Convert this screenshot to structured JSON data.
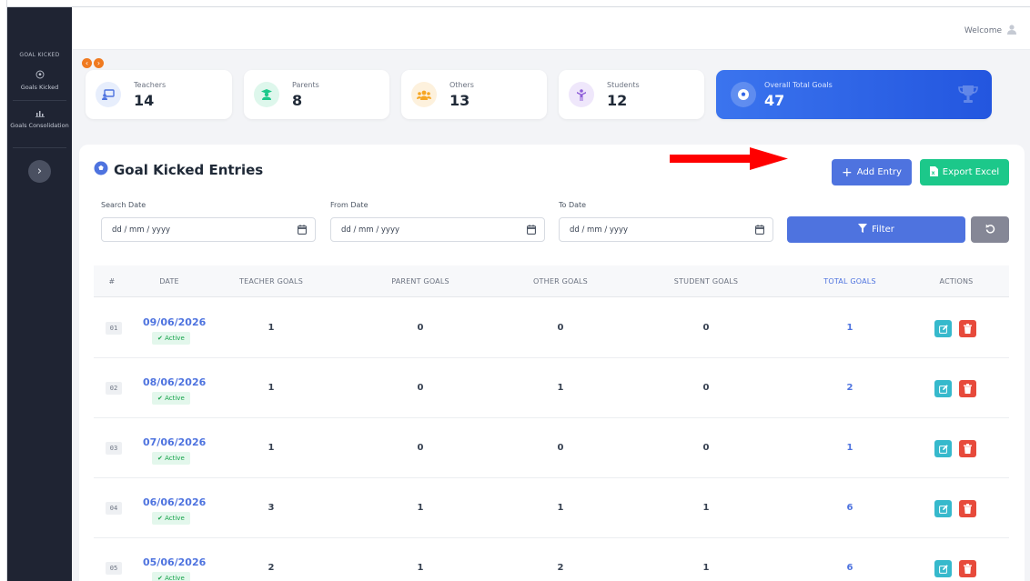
{
  "sidebar": {
    "brand": "GOAL KICKED",
    "items": [
      {
        "label": "Goals Kicked",
        "icon": "soccer-ball-icon"
      },
      {
        "label": "Goals Consolidation",
        "icon": "bar-chart-icon"
      }
    ],
    "toggle_icon": "chevron-right-icon"
  },
  "header": {
    "welcome": "Welcome"
  },
  "stats": [
    {
      "label": "Teachers",
      "value": "14",
      "icon": "chalkboard-teacher-icon",
      "color": "#4e73df",
      "bg": "#e7eefc"
    },
    {
      "label": "Parents",
      "value": "8",
      "icon": "user-graduate-icon",
      "color": "#1cc88a",
      "bg": "#def7ec"
    },
    {
      "label": "Others",
      "value": "13",
      "icon": "users-icon",
      "color": "#f6a623",
      "bg": "#fdf1dd"
    },
    {
      "label": "Students",
      "value": "12",
      "icon": "child-icon",
      "color": "#8e5dd8",
      "bg": "#efe7fb"
    }
  ],
  "total": {
    "label": "Overall Total Goals",
    "value": "47",
    "icon": "soccer-ball-icon"
  },
  "card": {
    "title": "Goal Kicked Entries",
    "add_label": "Add Entry",
    "export_label": "Export Excel",
    "filter_label": "Filter"
  },
  "filters": {
    "search_date": {
      "label": "Search Date",
      "value": "dd / mm / yyyy"
    },
    "from_date": {
      "label": "From Date",
      "value": "dd / mm / yyyy"
    },
    "to_date": {
      "label": "To Date",
      "value": "dd / mm / yyyy"
    }
  },
  "table": {
    "columns": [
      "#",
      "DATE",
      "TEACHER GOALS",
      "PARENT GOALS",
      "OTHER GOALS",
      "STUDENT GOALS",
      "TOTAL GOALS",
      "ACTIONS"
    ],
    "rows": [
      {
        "num": "01",
        "date": "09/06/2026",
        "status": "Active",
        "teacher": "1",
        "parent": "0",
        "other": "0",
        "student": "0",
        "total": "1"
      },
      {
        "num": "02",
        "date": "08/06/2026",
        "status": "Active",
        "teacher": "1",
        "parent": "0",
        "other": "1",
        "student": "0",
        "total": "2"
      },
      {
        "num": "03",
        "date": "07/06/2026",
        "status": "Active",
        "teacher": "1",
        "parent": "0",
        "other": "0",
        "student": "0",
        "total": "1"
      },
      {
        "num": "04",
        "date": "06/06/2026",
        "status": "Active",
        "teacher": "3",
        "parent": "1",
        "other": "1",
        "student": "1",
        "total": "6"
      },
      {
        "num": "05",
        "date": "05/06/2026",
        "status": "Active",
        "teacher": "2",
        "parent": "1",
        "other": "2",
        "student": "1",
        "total": "6"
      }
    ]
  },
  "colors": {
    "primary": "#4e73df",
    "success": "#1cc88a",
    "info": "#36b9cc",
    "danger": "#e74a3b",
    "annotation_arrow": "#ff0000"
  }
}
